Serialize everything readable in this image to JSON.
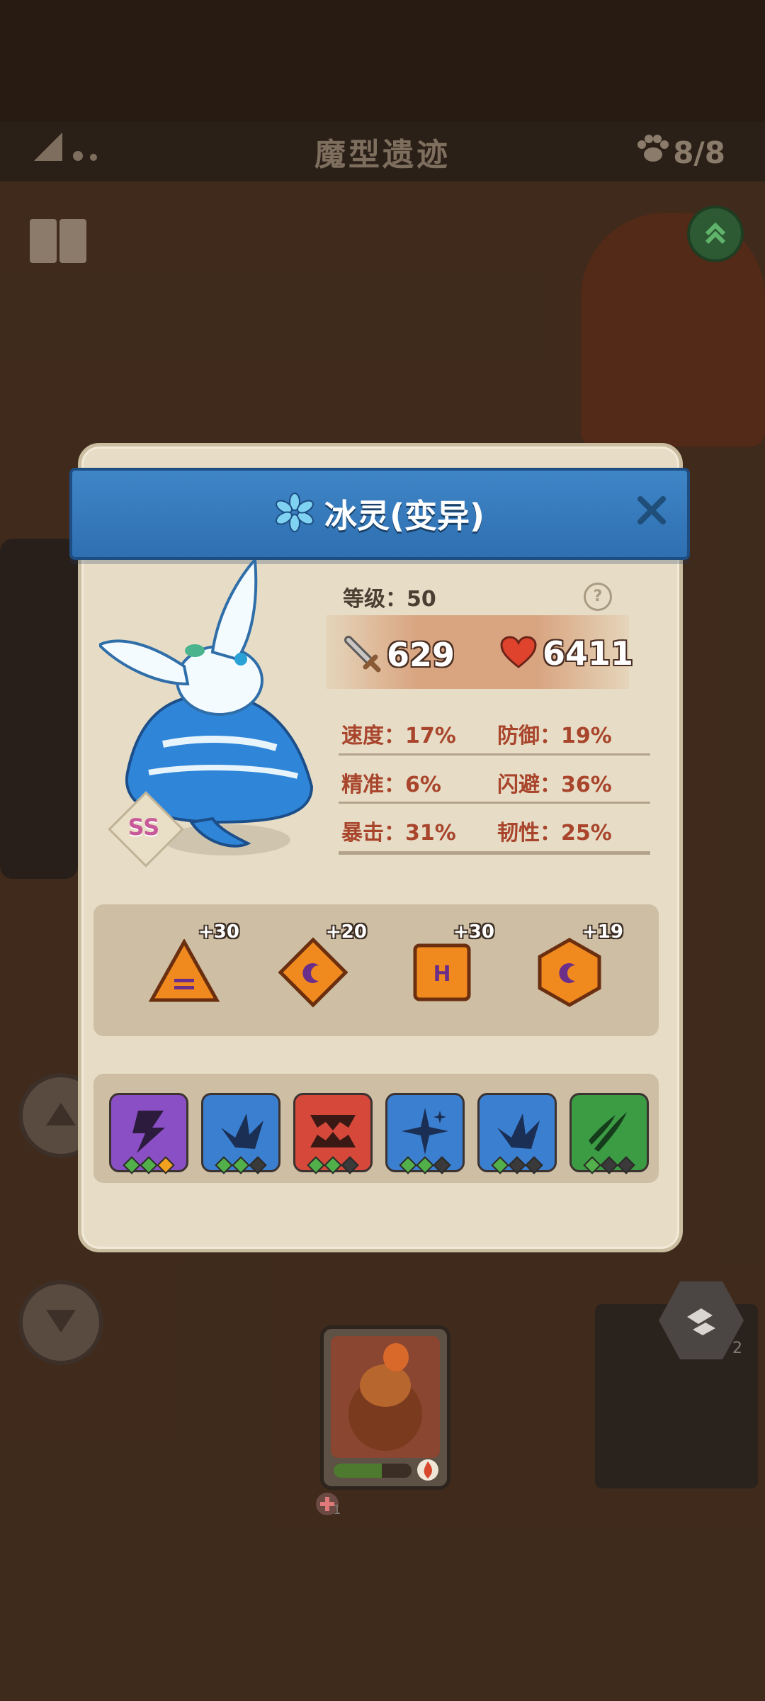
{
  "topbar": {
    "title": "魔型遗迹",
    "pet_count": "8/8"
  },
  "dialog": {
    "name": "冰灵(变异)",
    "level_label": "等级：50",
    "help": "?",
    "attack": "629",
    "hp": "6411",
    "grade": "SS",
    "stats": [
      {
        "label": "速度：17%"
      },
      {
        "label": "防御：19%"
      },
      {
        "label": "精准：6%"
      },
      {
        "label": "闪避：36%"
      },
      {
        "label": "暴击：31%"
      },
      {
        "label": "韧性：25%"
      }
    ],
    "runes": [
      {
        "bonus": "+30",
        "icon": "triangle-rune-icon"
      },
      {
        "bonus": "+20",
        "icon": "diamond-rune-icon"
      },
      {
        "bonus": "+30",
        "icon": "square-rune-icon"
      },
      {
        "bonus": "+19",
        "icon": "hexagon-rune-icon"
      }
    ],
    "skills": [
      {
        "icon": "lightning-skill-icon",
        "color": "#8a4fc4"
      },
      {
        "icon": "ice-wing-skill-icon",
        "color": "#3b7fd1"
      },
      {
        "icon": "fang-skill-icon",
        "color": "#d5483a"
      },
      {
        "icon": "star-skill-icon",
        "color": "#3b7fd1"
      },
      {
        "icon": "ice-wing-skill-icon",
        "color": "#3b7fd1"
      },
      {
        "icon": "claw-skill-icon",
        "color": "#3c9c44"
      }
    ]
  },
  "background": {
    "badge_count": "2",
    "card_badge": "1",
    "card_hp_fraction": 0.62
  }
}
